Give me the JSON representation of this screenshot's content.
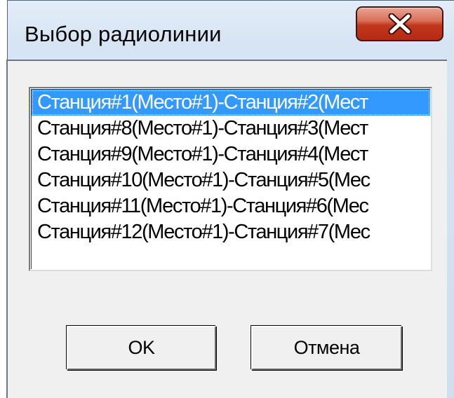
{
  "window": {
    "title": "Выбор радиолинии",
    "close_icon": "close-x-icon"
  },
  "listbox": {
    "selected_index": 0,
    "items": [
      "Станция#1(Место#1)-Станция#2(Мест",
      "Станция#8(Место#1)-Станция#3(Мест",
      "Станция#9(Место#1)-Станция#4(Мест",
      "Станция#10(Место#1)-Станция#5(Мес",
      "Станция#11(Место#1)-Станция#6(Мес",
      "Станция#12(Место#1)-Станция#7(Мес"
    ]
  },
  "buttons": {
    "ok_label": "OK",
    "cancel_label": "Отмена"
  },
  "colors": {
    "selection": "#3399ff",
    "close_button": "#c0371d"
  }
}
